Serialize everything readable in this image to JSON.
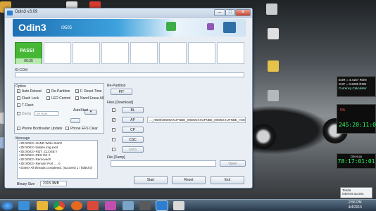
{
  "window": {
    "title": "Odin3 v3.09",
    "min": "–",
    "max": "□",
    "close": "✕"
  },
  "banner": {
    "brand": "Odin3",
    "model": "I9505"
  },
  "status": {
    "pass_label": "PASS!",
    "pass_time": "00:35",
    "id_com": "ID:COM"
  },
  "option": {
    "header": "Option",
    "auto_reboot": "Auto Reboot",
    "re_partition": "Re-Partition",
    "f_reset_time": "F. Reset Time",
    "flash_lock": "Flash Lock",
    "led_control": "LED Control",
    "nand_erase_all": "Nand Erase All",
    "t_flash": "T Flash",
    "dump": "Dump",
    "dump_select": "AP RAM",
    "autostart": "AutoStart",
    "phone_bootloader": "Phone Bootloader Update",
    "phone_efs": "Phone EFS Clear"
  },
  "repartition": {
    "header": "Re-Partition",
    "pit": "PIT"
  },
  "files": {
    "header": "Files [Download]",
    "rows": [
      {
        "btn": "BL",
        "path": ""
      },
      {
        "btn": "AP",
        "path": "..._I9505\\I9505XXUFNBE_I9505OXXUFNBE_I9505XXUFNBE_HOME.tar.md5",
        "checked": true
      },
      {
        "btn": "CP",
        "path": ""
      },
      {
        "btn": "CSC",
        "path": ""
      },
      {
        "btn": "UMS",
        "path": ""
      }
    ]
  },
  "dumpfile": {
    "header": "File [Dump]",
    "open": "Open"
  },
  "message": {
    "header": "Message",
    "lines": [
      "<ID:0/003> NAND Write Start!!",
      "<ID:0/003> hidden.img.ext4",
      "<ID:0/003> RQT_CLOSE !!",
      "<ID:0/003> RES OK !!",
      "<ID:0/003> Removed!!",
      "<ID:0/003> Remain Port .... 0",
      "<OSM> All threads completed. (succeed 1 / failed 0)"
    ]
  },
  "binary": {
    "label": "Binary Size",
    "value": "2315.3MB"
  },
  "buttons": {
    "start": "Start",
    "reset": "Reset",
    "exit": "Exit"
  },
  "gadgets": {
    "eur": "EUR = 4.4157 RON",
    "chf": "CHF = 3.2290 RON",
    "calc": "Currency Calculator",
    "cpu": "5%",
    "time1": "245:20:11:01",
    "date_label": "Diketuja",
    "time2": "78:17:01:01"
  },
  "taskbar": {
    "notice_title": "Tenda",
    "notice_body": "Internet access",
    "time": "2:56 PM",
    "date": "4/4/2015"
  },
  "colors": {
    "pass": "#46b836",
    "banner": "#1e6fb3"
  }
}
